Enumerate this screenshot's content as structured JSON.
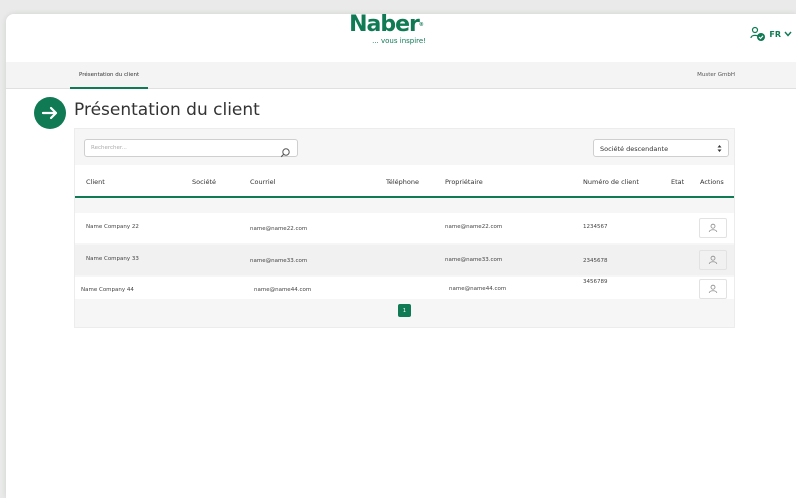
{
  "header": {
    "logo_text": "Naber",
    "logo_registered": "®",
    "logo_tagline": "... vous inspire!",
    "language": "FR"
  },
  "tabs": [
    {
      "label": "Présentation du client",
      "active": true
    }
  ],
  "company": "Muster GmbH",
  "page_title": "Présentation du client",
  "search": {
    "placeholder": "Rechercher..."
  },
  "filter": {
    "selected": "Société descendante"
  },
  "table": {
    "columns": [
      "Client",
      "Société",
      "Courriel",
      "Téléphone",
      "Propriétaire",
      "Numéro de client",
      "Etat",
      "Actions"
    ],
    "rows": [
      {
        "client": "Name Company 22",
        "societe": "",
        "courriel": "name@name22.com",
        "telephone": "",
        "proprietaire": "name@name22.com",
        "numero": "1234567",
        "etat": ""
      },
      {
        "client": "Name Company 33",
        "societe": "",
        "courriel": "name@name33.com",
        "telephone": "",
        "proprietaire": "name@name33.com",
        "numero": "2345678",
        "etat": ""
      },
      {
        "client": "Name Company 44",
        "societe": "",
        "courriel": "name@name44.com",
        "telephone": "",
        "proprietaire": "name@name44.com",
        "numero": "3456789",
        "etat": ""
      }
    ]
  },
  "pagination": {
    "current": "1"
  },
  "colors": {
    "brand": "#0f7a54",
    "row_alt": "#f1f1f1"
  },
  "icons": [
    "user-check-icon",
    "chevron-down-icon",
    "arrow-right-icon",
    "search-icon",
    "user-icon"
  ]
}
